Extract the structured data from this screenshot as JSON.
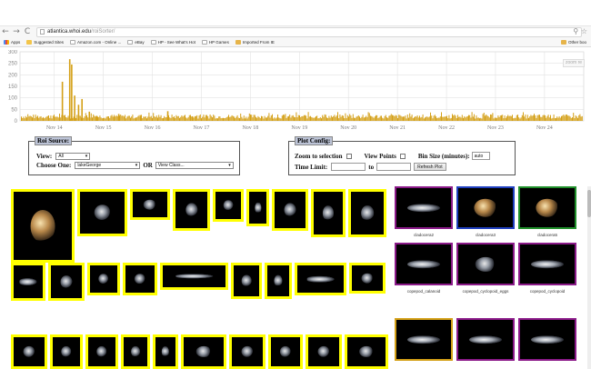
{
  "browser": {
    "url_host": "atlantica.whoi.edu",
    "url_path": "/roiSorter/",
    "bookmarks": [
      {
        "label": "Apps",
        "icon": "apps-icon"
      },
      {
        "label": "Suggested Sites",
        "icon": "star-icon"
      },
      {
        "label": "Amazon.com - Online ...",
        "icon": "page-icon"
      },
      {
        "label": "eBay",
        "icon": "page-icon"
      },
      {
        "label": "HP - See What's Hot",
        "icon": "page-icon"
      },
      {
        "label": "HP Games",
        "icon": "page-icon"
      },
      {
        "label": "Imported From IE",
        "icon": "folder-icon"
      }
    ],
    "other_bookmarks": "Other boo"
  },
  "chart_data": {
    "type": "bar",
    "bar_color": "#d4a017",
    "x_tick_labels": [
      "Nov 14",
      "Nov 15",
      "Nov 16",
      "Nov 17",
      "Nov 18",
      "Nov 19",
      "Nov 20",
      "Nov 21",
      "Nov 22",
      "Nov 23",
      "Nov 24"
    ],
    "y_tick_labels": [
      "0",
      "50",
      "100",
      "150",
      "200",
      "250",
      "300"
    ],
    "ylim": [
      0,
      300
    ],
    "grid": true,
    "zoom_button": "zoom re",
    "spikes": [
      {
        "day": 14.15,
        "value": 170
      },
      {
        "day": 14.3,
        "value": 268
      },
      {
        "day": 14.34,
        "value": 245
      },
      {
        "day": 14.4,
        "value": 110
      },
      {
        "day": 14.48,
        "value": 70
      },
      {
        "day": 14.55,
        "value": 95
      },
      {
        "day": 14.7,
        "value": 40
      },
      {
        "day": 14.85,
        "value": 22
      },
      {
        "day": 15.3,
        "value": 30
      },
      {
        "day": 15.75,
        "value": 25
      },
      {
        "day": 16.3,
        "value": 42
      },
      {
        "day": 16.8,
        "value": 20
      }
    ],
    "baseline_range": [
      10,
      28
    ]
  },
  "roi_source": {
    "legend": "Roi Source:",
    "view_label": "View:",
    "view_value": "All",
    "choose_label": "Choose One:",
    "choose_value": "lakeGeorge",
    "or_label": "OR",
    "class_value": "View Class..."
  },
  "plot_config": {
    "legend": "Plot Config:",
    "zoom_label": "Zoom to selection",
    "view_points_label": "View Points",
    "bin_size_label": "Bin Size (minutes):",
    "bin_size_value": "auto",
    "time_limit_label": "Time Limit:",
    "to_label": "to",
    "time_from": "",
    "time_to": "",
    "refresh_label": "Refresh Plot"
  },
  "classes": [
    {
      "label": "cladocera2",
      "border": "#8b1a89",
      "org": "cop"
    },
    {
      "label": "cladocera3",
      "border": "#1f3fbf",
      "org": "cld"
    },
    {
      "label": "cladocera5",
      "border": "#1f8f2a",
      "org": "cld"
    },
    {
      "label": "copepod_calanoid",
      "border": "#8b1a89",
      "org": "cop"
    },
    {
      "label": "copepod_cyclopoid_eggs",
      "border": "#8b1a89",
      "org": "sm"
    },
    {
      "label": "copepod_cyclopoid",
      "border": "#8b1a89",
      "org": "cop"
    },
    {
      "label": "",
      "border": "#d4a017",
      "org": "cop"
    },
    {
      "label": "",
      "border": "#8b1a89",
      "org": "cop"
    },
    {
      "label": "",
      "border": "#8b1a89",
      "org": "cop"
    }
  ],
  "colors": {
    "roi_border": "#ffff00",
    "legend_bg": "#bcc3d6"
  }
}
